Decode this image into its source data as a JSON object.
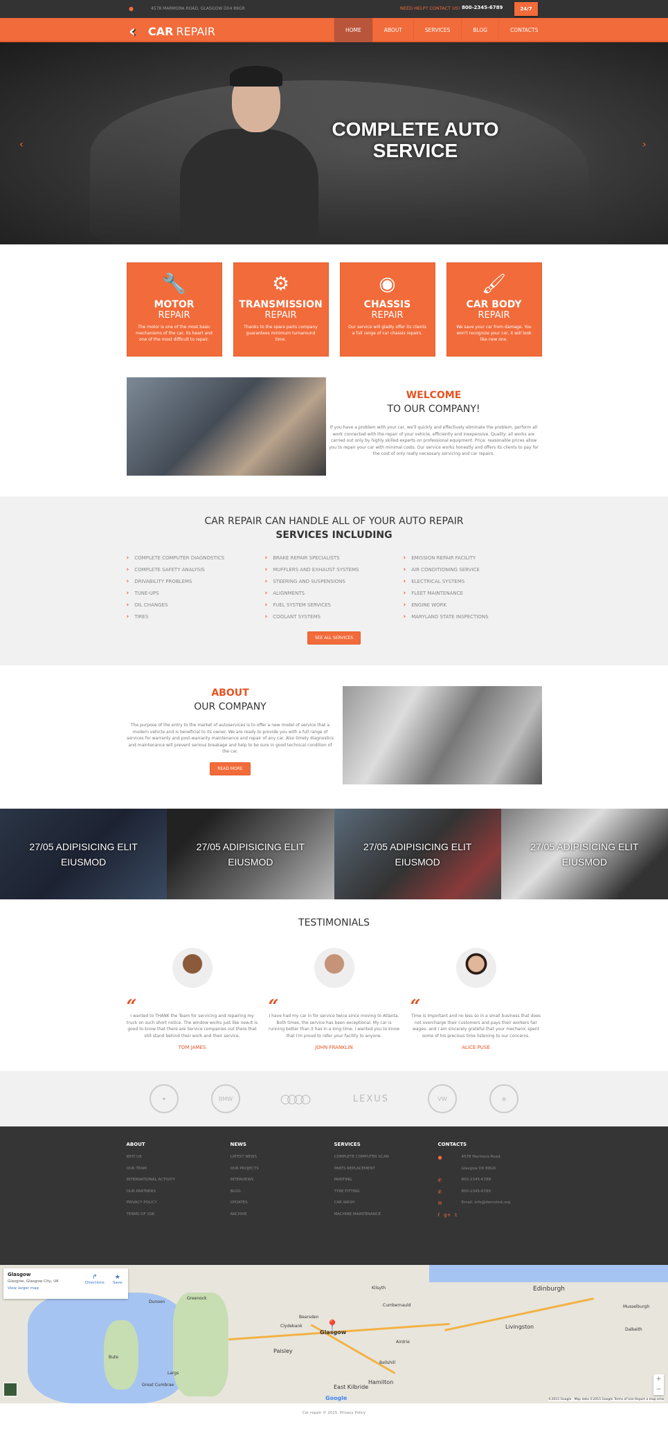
{
  "topbar": {
    "address": "4578 MARMORA ROAD, GLASGOW D04 89GR",
    "help_text": "NEED HELP? CONTACT US!",
    "phone": "800-2345-6789",
    "badge": "24/7"
  },
  "header": {
    "logo_bold": "CAR",
    "logo_light": "REPAIR",
    "nav": [
      {
        "label": "HOME",
        "active": true
      },
      {
        "label": "ABOUT"
      },
      {
        "label": "SERVICES"
      },
      {
        "label": "BLOG"
      },
      {
        "label": "CONTACTS"
      }
    ]
  },
  "hero": {
    "title_line1": "COMPLETE AUTO",
    "title_line2": "SERVICE",
    "prev": "‹",
    "next": "›"
  },
  "features": [
    {
      "icon": "piston-icon",
      "glyph": "🔧",
      "title": "MOTOR",
      "subtitle": "REPAIR",
      "text": "The motor is one of the most basic mechanisms of the car, its heart and one of the most difficult to repair."
    },
    {
      "icon": "gears-icon",
      "glyph": "⚙",
      "title": "TRANSMISSION",
      "subtitle": "REPAIR",
      "text": "Thanks to the spare parts company guarantees minimum turnaround time."
    },
    {
      "icon": "brake-disc-icon",
      "glyph": "◉",
      "title": "CHASSIS",
      "subtitle": "REPAIR",
      "text": "Our service will gladly offer its clients a full range of car chassis repairs."
    },
    {
      "icon": "paint-brush-icon",
      "glyph": "🖌",
      "title": "CAR BODY",
      "subtitle": "REPAIR",
      "text": "We save your car from damage. You won't recognize your car, it will look like new one."
    }
  ],
  "welcome": {
    "title": "WELCOME",
    "subtitle": "TO OUR COMPANY!",
    "text": "If you have a problem with your car, we'll quickly and effectively eliminate the problem, perform all work connected with the repair of your vehicle, efficiently and inexpensive. Quality: all works are carried out only by highly skilled experts on professional equipment. Price: reasonable prices allow you to repair your car with minimal costs. Our service works honestly and offers its clients to pay for the cost of only really necessary servicing and car repairs."
  },
  "services": {
    "title": "CAR REPAIR CAN HANDLE ALL OF YOUR AUTO REPAIR",
    "subtitle": "SERVICES INCLUDING",
    "columns": [
      [
        "COMPLETE COMPUTER DIAGNOSTICS",
        "COMPLETE SAFETY ANALYSIS",
        "DRIVABILITY PROBLEMS",
        "TUNE-UPS",
        "OIL CHANGES",
        "TIRES"
      ],
      [
        "BRAKE REPAIR SPECIALISTS",
        "MUFFLERS AND EXHAUST SYSTEMS",
        "STEERING AND SUSPENSIONS",
        "ALIGNMENTS",
        "FUEL SYSTEM SERVICES",
        "COOLANT SYSTEMS"
      ],
      [
        "EMISSION REPAIR FACILITY",
        "AIR CONDITIONING SERVICE",
        "ELECTRICAL SYSTEMS",
        "FLEET MAINTENANCE",
        "ENGINE WORK",
        "MARYLAND STATE INSPECTIONS"
      ]
    ],
    "button": "SEE ALL SERVICES"
  },
  "about": {
    "title": "ABOUT",
    "subtitle": "OUR COMPANY",
    "text": "The purpose of the entry to the market of autoservices is to offer a new model of service that a modern vehicle and is beneficial to its owner. We are ready to provide you with a full range of services for warranty and post-warranty maintenance and repair of any car. Also timely diagnostics and maintenance will prevent serious breakage and help to be sure in good technical condition of the car.",
    "button": "READ MORE"
  },
  "gallery": [
    {
      "line1": "27/05 ADIPISICING ELIT",
      "line2": "EIUSMOD"
    },
    {
      "line1": "27/05 ADIPISICING ELIT",
      "line2": "EIUSMOD"
    },
    {
      "line1": "27/05 ADIPISICING ELIT",
      "line2": "EIUSMOD"
    },
    {
      "line1": "27/05 ADIPISICING ELIT",
      "line2": "EIUSMOD"
    }
  ],
  "testimonials": {
    "title": "TESTIMONIALS",
    "items": [
      {
        "text": "I wanted to THANK the Team for servicing and repairing my truck on such short notice. The window works just like new.It is good to know that there are Service companies out there that still stand behind their work and their service.",
        "name": "TOM JAMES"
      },
      {
        "text": "I have had my car in for service twice since moving to Atlanta. Both times, the service has been exceptional. My car is running better than it has in a long time. I wanted you to know that I'm proud to refer your facility to anyone.",
        "name": "JOHN FRANKLIN"
      },
      {
        "text": "Time is important and no less so in a small business that does not overcharge their customers and pays their workers fair wages- and I am sincerely grateful that your mechanic spent some of his precious time listening to our concerns.",
        "name": "ALICE PUSE"
      }
    ]
  },
  "brands": [
    {
      "name": "mercedes-logo",
      "label": "✦"
    },
    {
      "name": "bmw-logo",
      "label": "BMW"
    },
    {
      "name": "audi-logo",
      "label": "○○○○"
    },
    {
      "name": "lexus-logo",
      "label": "LEXUS"
    },
    {
      "name": "volkswagen-logo",
      "label": "VW"
    },
    {
      "name": "toyota-logo",
      "label": "⊕"
    }
  ],
  "footer": {
    "about": {
      "title": "ABOUT",
      "links": [
        "WHY US",
        "OUR TEAM",
        "INTERNATIONAL ACTIVITY",
        "OUR PARTNERS",
        "PRIVACY POLICY",
        "TERMS OF USE"
      ]
    },
    "news": {
      "title": "NEWS",
      "links": [
        "LATEST NEWS",
        "OUR PROJECTS",
        "INTERVIEWS",
        "BLOG",
        "UPDATES",
        "ARCHIVE"
      ]
    },
    "services": {
      "title": "SERVICES",
      "links": [
        "COMPLETE COMPUTER SCAN",
        "PARTS REPLACEMENT",
        "PAINTING",
        "TYRE FITTING",
        "CAR WASH",
        "MACHINE MAINTENANCE"
      ]
    },
    "contacts": {
      "title": "CONTACTS",
      "address1": "4578 Marmora Road,",
      "address2": "Glasgow D0 89GR",
      "phone1": "800-2345-6788",
      "phone2": "800-2345-6789",
      "email": "Email: info@demolink.org",
      "social": [
        "f",
        "g+",
        "t"
      ]
    }
  },
  "map": {
    "place_name": "Glasgow",
    "place_address": "Glasgow, Glasgow City, UK",
    "larger_map": "View larger map",
    "directions": "Directions",
    "save": "Save",
    "marker_city": "Glasgow",
    "cities": [
      "Edinburgh",
      "Paisley",
      "Hamilton",
      "East Kilbride",
      "Livingston",
      "Bute",
      "Great Cumbrae",
      "Greenock",
      "Dunoon",
      "Largs",
      "Clydebank",
      "Bearsden",
      "Cumbernauld",
      "Kilsyth",
      "Airdrie",
      "Bellshill",
      "Dalkeith",
      "Musselburgh"
    ],
    "attribution": "©2015 Google · Map data ©2015 Google   Terms of Use   Report a map error",
    "google": "Google"
  },
  "copyright": "Car repair © 2015.  Privacy Policy"
}
